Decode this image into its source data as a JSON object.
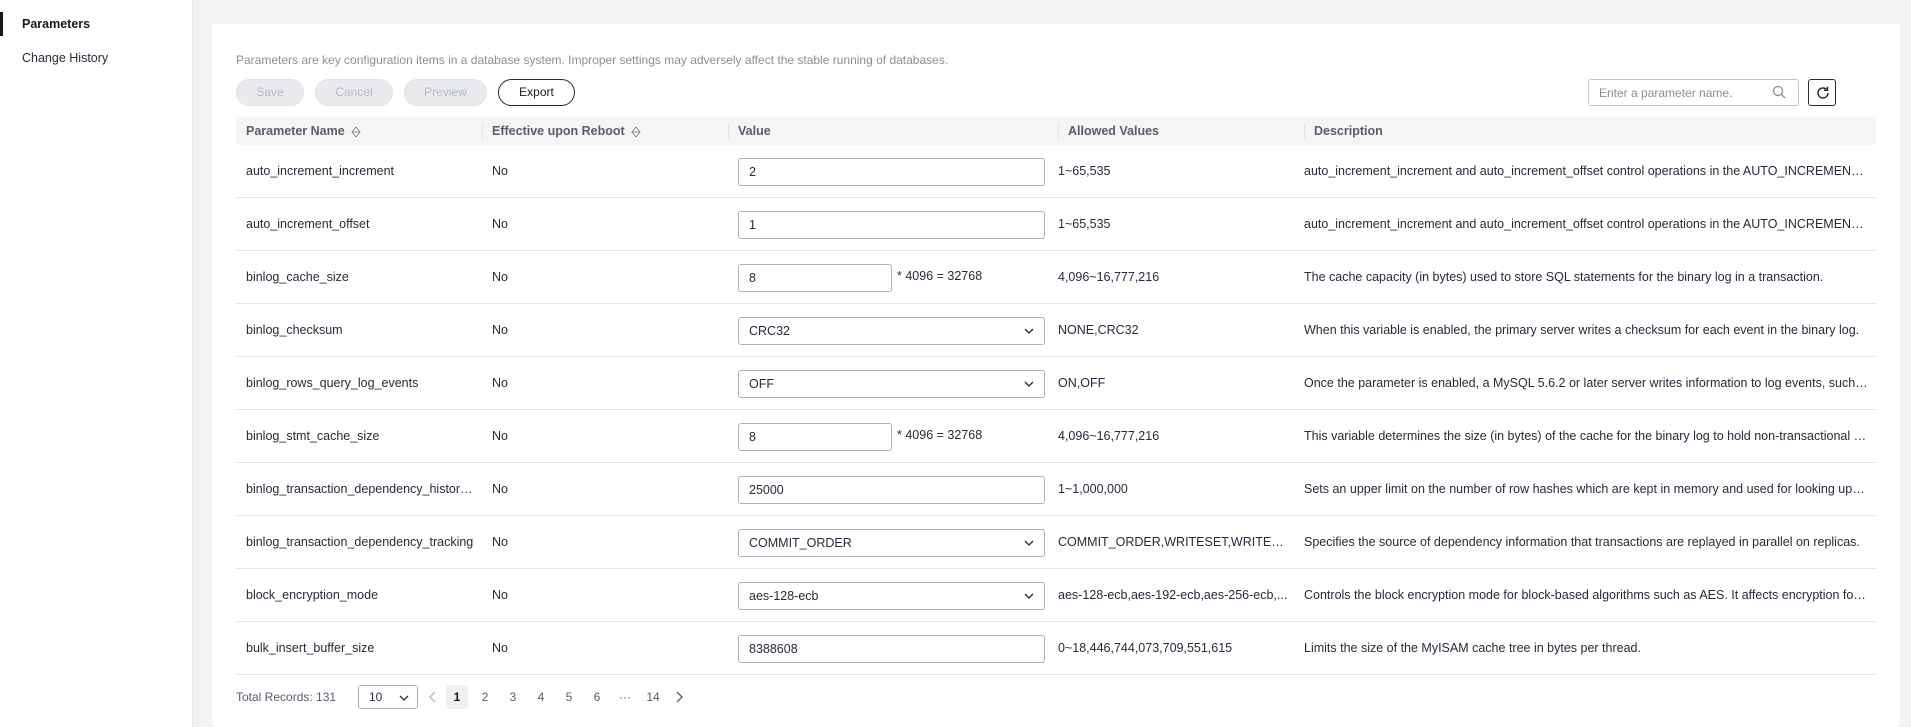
{
  "sidebar": {
    "items": [
      {
        "label": "Parameters"
      },
      {
        "label": "Change History"
      }
    ]
  },
  "notice": "Parameters are key configuration items in a database system. Improper settings may adversely affect the stable running of databases.",
  "toolbar": {
    "save": "Save",
    "cancel": "Cancel",
    "preview": "Preview",
    "export": "Export",
    "search_placeholder": "Enter a parameter name."
  },
  "columns": {
    "name": "Parameter Name",
    "reboot": "Effective upon Reboot",
    "value": "Value",
    "allowed": "Allowed Values",
    "description": "Description"
  },
  "rows": [
    {
      "name": "auto_increment_increment",
      "reboot": "No",
      "value": "2",
      "allowed": "1~65,535",
      "description": "auto_increment_increment and auto_increment_offset control operations in the AUTO_INCREMENT c..."
    },
    {
      "name": "auto_increment_offset",
      "reboot": "No",
      "value": "1",
      "allowed": "1~65,535",
      "description": "auto_increment_increment and auto_increment_offset control operations in the AUTO_INCREMENT c..."
    },
    {
      "name": "binlog_cache_size",
      "reboot": "No",
      "value": "8",
      "multiplier": "* 4096 = 32768",
      "allowed": "4,096~16,777,216",
      "description": "The cache capacity (in bytes) used to store SQL statements for the binary log in a transaction."
    },
    {
      "name": "binlog_checksum",
      "reboot": "No",
      "value": "CRC32",
      "allowed": "NONE,CRC32",
      "description": "When this variable is enabled, the primary server writes a checksum for each event in the binary log."
    },
    {
      "name": "binlog_rows_query_log_events",
      "reboot": "No",
      "value": "OFF",
      "allowed": "ON,OFF",
      "description": "Once the parameter is enabled, a MySQL 5.6.2 or later server writes information to log events, such a..."
    },
    {
      "name": "binlog_stmt_cache_size",
      "reboot": "No",
      "value": "8",
      "multiplier": "* 4096 = 32768",
      "allowed": "4,096~16,777,216",
      "description": "This variable determines the size (in bytes) of the cache for the binary log to hold non-transactional st..."
    },
    {
      "name": "binlog_transaction_dependency_history...",
      "reboot": "No",
      "value": "25000",
      "allowed": "1~1,000,000",
      "description": "Sets an upper limit on the number of row hashes which are kept in memory and used for looking up th..."
    },
    {
      "name": "binlog_transaction_dependency_tracking",
      "reboot": "No",
      "value": "COMMIT_ORDER",
      "allowed": "COMMIT_ORDER,WRITESET,WRITES...",
      "description": "Specifies the source of dependency information that transactions are replayed in parallel on replicas."
    },
    {
      "name": "block_encryption_mode",
      "reboot": "No",
      "value": "aes-128-ecb",
      "allowed": "aes-128-ecb,aes-192-ecb,aes-256-ecb,...",
      "description": "Controls the block encryption mode for block-based algorithms such as AES. It affects encryption for ..."
    },
    {
      "name": "bulk_insert_buffer_size",
      "reboot": "No",
      "value": "8388608",
      "allowed": "0~18,446,744,073,709,551,615",
      "description": "Limits the size of the MyISAM cache tree in bytes per thread."
    }
  ],
  "footer": {
    "total": "Total Records: 131",
    "page_size": "10",
    "pages": [
      "1",
      "2",
      "3",
      "4",
      "5",
      "6",
      "···",
      "14"
    ]
  }
}
